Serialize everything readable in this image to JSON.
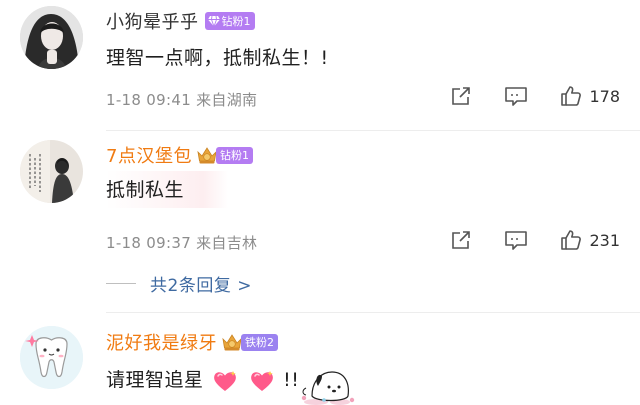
{
  "comments": [
    {
      "username": "小狗晕乎乎",
      "username_color": "#333333",
      "badge": "钻粉1",
      "badge_color": "#b47cf2",
      "text": "理智一点啊，抵制私生！!",
      "time": "1-18 09:41",
      "location": "来自湖南",
      "likes": "178"
    },
    {
      "username": "7点汉堡包",
      "username_color": "#f07b12",
      "badge": "钻粉1",
      "badge_color": "#b47cf2",
      "text": "抵制私生",
      "time": "1-18 09:37",
      "location": "来自吉林",
      "likes": "231",
      "replies_label": "共2条回复 >"
    },
    {
      "username": "泥好我是绿牙",
      "username_color": "#f07b12",
      "badge": "铁粉2",
      "badge_color": "#9b82f0",
      "text_prefix": "请理智追星",
      "text_suffix": "!!"
    }
  ],
  "icons": {
    "share": "share-icon",
    "comment": "comment-icon",
    "like": "thumbs-up-icon",
    "badge_gem": "diamond-icon",
    "badge_crown": "crown-icon",
    "emoji": "heart-emoji-icon",
    "sticker": "pochacco-sticker"
  },
  "colors": {
    "meta": "#8c8c8c",
    "reply_link": "#3f6aa1",
    "heart": "#ff5a8a"
  }
}
